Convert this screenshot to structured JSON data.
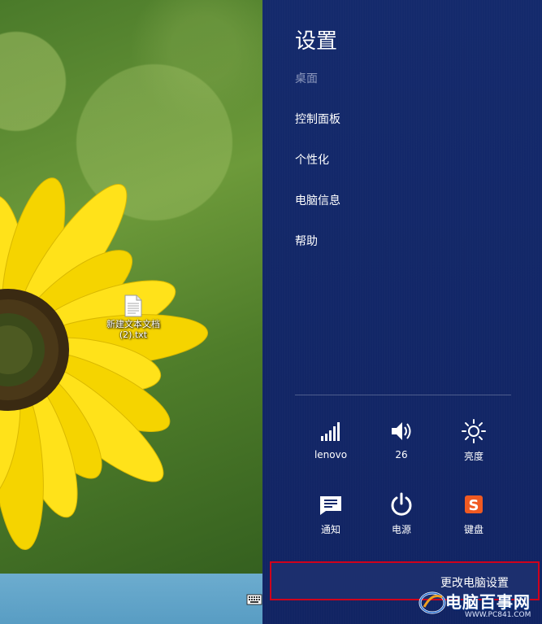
{
  "desktop": {
    "file_name": "新建文本文档 (2).txt"
  },
  "panel": {
    "title": "设置",
    "menu": [
      {
        "label": "桌面"
      },
      {
        "label": "控制面板"
      },
      {
        "label": "个性化"
      },
      {
        "label": "电脑信息"
      },
      {
        "label": "帮助"
      }
    ],
    "tiles": [
      {
        "label": "lenovo",
        "icon": "wifi-signal-icon"
      },
      {
        "label": "26",
        "icon": "volume-icon"
      },
      {
        "label": "亮度",
        "icon": "brightness-icon"
      },
      {
        "label": "通知",
        "icon": "notification-icon"
      },
      {
        "label": "电源",
        "icon": "power-icon"
      },
      {
        "label": "键盘",
        "icon": "sogou-keyboard-icon"
      }
    ],
    "change_settings_label": "更改电脑设置"
  },
  "watermark": {
    "text": "电脑百事网",
    "url": "WWW.PC841.COM"
  },
  "colors": {
    "panel_bg": "#13286a",
    "highlight_border": "#d0021b",
    "sogou_orange": "#f05a22"
  }
}
